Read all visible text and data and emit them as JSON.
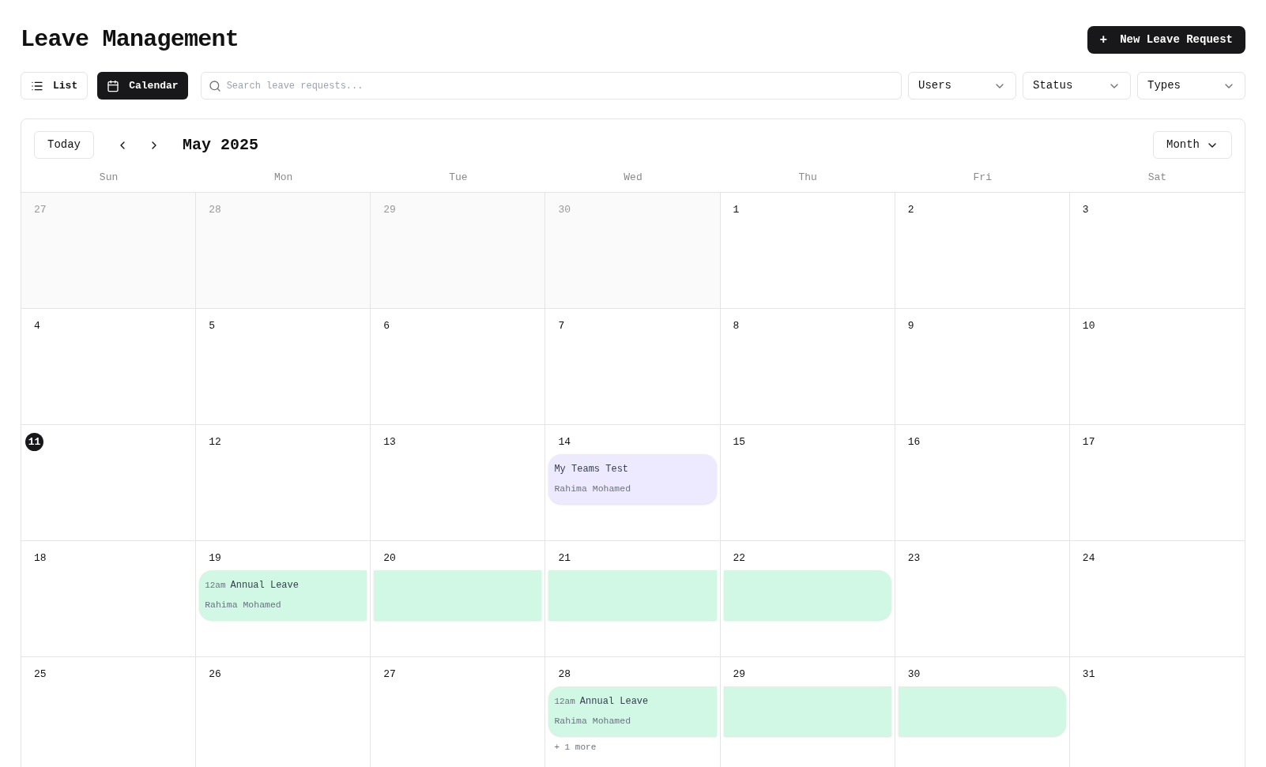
{
  "title": "Leave Management",
  "new_button": {
    "icon": "+",
    "label": "New Leave Request"
  },
  "views": [
    {
      "label": "List",
      "kind": "list",
      "selected": false
    },
    {
      "label": "Calendar",
      "kind": "calendar",
      "selected": true
    }
  ],
  "search": {
    "placeholder": "Search leave requests..."
  },
  "filters": [
    "Users",
    "Status",
    "Types"
  ],
  "calendar": {
    "today_label": "Today",
    "month": "May 2025",
    "view": "Month",
    "weekdays": [
      "Sun",
      "Mon",
      "Tue",
      "Wed",
      "Thu",
      "Fri",
      "Sat"
    ],
    "weeks": [
      [
        {
          "day": "27",
          "outside": true
        },
        {
          "day": "28",
          "outside": true
        },
        {
          "day": "29",
          "outside": true
        },
        {
          "day": "30",
          "outside": true
        },
        {
          "day": "1",
          "outside": false
        },
        {
          "day": "2",
          "outside": false
        },
        {
          "day": "3",
          "outside": false
        }
      ],
      [
        {
          "day": "4",
          "outside": false
        },
        {
          "day": "5",
          "outside": false
        },
        {
          "day": "6",
          "outside": false
        },
        {
          "day": "7",
          "outside": false
        },
        {
          "day": "8",
          "outside": false
        },
        {
          "day": "9",
          "outside": false
        },
        {
          "day": "10",
          "outside": false
        }
      ],
      [
        {
          "day": "11",
          "outside": false,
          "today": true
        },
        {
          "day": "12",
          "outside": false
        },
        {
          "day": "13",
          "outside": false
        },
        {
          "day": "14",
          "outside": false,
          "event": {
            "kind": "single",
            "color": "#ede9fe",
            "title": "My Teams Test",
            "person": "Rahima Mohamed"
          }
        },
        {
          "day": "15",
          "outside": false
        },
        {
          "day": "16",
          "outside": false
        },
        {
          "day": "17",
          "outside": false
        }
      ],
      [
        {
          "day": "18",
          "outside": false
        },
        {
          "day": "19",
          "outside": false,
          "event": {
            "kind": "start",
            "color": "#d1f7e5",
            "time": "12am",
            "title": "Annual Leave",
            "person": "Rahima Mohamed"
          }
        },
        {
          "day": "20",
          "outside": false,
          "event": {
            "kind": "middle",
            "color": "#d1f7e5"
          }
        },
        {
          "day": "21",
          "outside": false,
          "event": {
            "kind": "middle",
            "color": "#d1f7e5"
          }
        },
        {
          "day": "22",
          "outside": false,
          "event": {
            "kind": "end",
            "color": "#d1f7e5"
          }
        },
        {
          "day": "23",
          "outside": false
        },
        {
          "day": "24",
          "outside": false
        }
      ],
      [
        {
          "day": "25",
          "outside": false
        },
        {
          "day": "26",
          "outside": false
        },
        {
          "day": "27",
          "outside": false
        },
        {
          "day": "28",
          "outside": false,
          "event": {
            "kind": "start",
            "color": "#d1f7e5",
            "time": "12am",
            "title": "Annual Leave",
            "person": "Rahima Mohamed"
          },
          "more": "+ 1 more"
        },
        {
          "day": "29",
          "outside": false,
          "event": {
            "kind": "middle",
            "color": "#d1f7e5"
          }
        },
        {
          "day": "30",
          "outside": false,
          "event": {
            "kind": "end",
            "color": "#d1f7e5"
          }
        },
        {
          "day": "31",
          "outside": false
        }
      ]
    ]
  }
}
